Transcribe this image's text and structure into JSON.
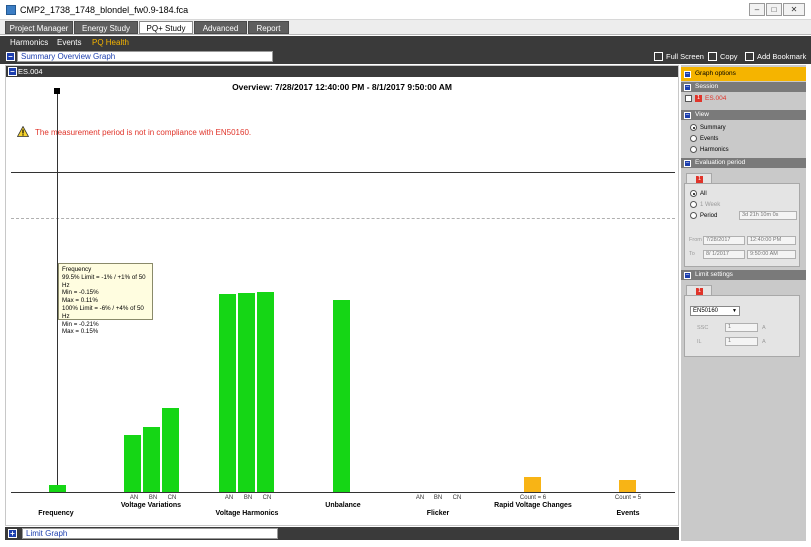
{
  "window": {
    "title": "CMP2_1738_1748_blondel_fw0.9-184.fca",
    "buttons": {
      "minimize": "–",
      "maximize": "□",
      "close": "✕"
    }
  },
  "main_tabs": [
    "Project Manager",
    "Energy Study",
    "PQ+ Study",
    "Advanced",
    "Report"
  ],
  "active_tab": "PQ+ Study",
  "sub_nav": [
    "Harmonics",
    "Events",
    "PQ Health"
  ],
  "active_sub": "PQ Health",
  "toolbar": {
    "panel_title": "Summary Overview Graph",
    "expand_symbol": "–",
    "full_screen": "Full Screen",
    "copy": "Copy",
    "add_bookmark": "Add Bookmark"
  },
  "graph": {
    "session_label": "ES.004",
    "overview": "Overview: 7/28/2017 12:40:00 PM - 8/1/2017 9:50:00 AM",
    "warning": "The measurement period is not in compliance with EN50160.",
    "tooltip": [
      "Frequency",
      "99.5% Limit = -1% / +1% of 50 Hz",
      "Min = -0.15%",
      "Max = 0.11%",
      "100% Limit = -6% / +4% of 50 Hz",
      "Min = -0.21%",
      "Max = 0.15%"
    ]
  },
  "chart_data": {
    "type": "bar",
    "categories": [
      "Frequency",
      "Voltage Variations",
      "Voltage Harmonics",
      "Unbalance",
      "Flicker",
      "Rapid Voltage Changes",
      "Events"
    ],
    "bars": [
      {
        "category": "Frequency",
        "phase": "",
        "value": 0.035,
        "color": "green"
      },
      {
        "category": "Voltage Variations",
        "phase": "AN",
        "value": 0.3,
        "color": "green"
      },
      {
        "category": "Voltage Variations",
        "phase": "BN",
        "value": 0.34,
        "color": "green"
      },
      {
        "category": "Voltage Variations",
        "phase": "CN",
        "value": 0.44,
        "color": "green"
      },
      {
        "category": "Voltage Harmonics",
        "phase": "AN",
        "value": 1.04,
        "color": "green"
      },
      {
        "category": "Voltage Harmonics",
        "phase": "BN",
        "value": 1.045,
        "color": "green"
      },
      {
        "category": "Voltage Harmonics",
        "phase": "CN",
        "value": 1.055,
        "color": "green"
      },
      {
        "category": "Unbalance",
        "phase": "",
        "value": 1.01,
        "color": "green"
      },
      {
        "category": "Flicker",
        "phase": "AN",
        "value": 0,
        "color": "green"
      },
      {
        "category": "Flicker",
        "phase": "BN",
        "value": 0,
        "color": "green"
      },
      {
        "category": "Flicker",
        "phase": "CN",
        "value": 0,
        "color": "green"
      },
      {
        "category": "Rapid Voltage Changes",
        "phase": "Count = 6",
        "value": 0.08,
        "color": "amber"
      },
      {
        "category": "Events",
        "phase": "Count = 5",
        "value": 0.065,
        "color": "amber"
      }
    ],
    "reference_lines": {
      "solid_limit": 1.0,
      "dashed_limit": 1.3
    },
    "colors": {
      "ok": "#15d615",
      "warn": "#f8b415"
    }
  },
  "bottom": {
    "panel_title": "Limit Graph",
    "expand_symbol": "+"
  },
  "sidebar": {
    "graph_options": "Graph options",
    "session_header": "Session",
    "session_item": "ES.004",
    "session_badge": "1",
    "view_header": "View",
    "view_options": [
      "Summary",
      "Events",
      "Harmonics"
    ],
    "view_selected": "Summary",
    "eval_header": "Evaluation period",
    "eval_badge": "1",
    "eval_options": [
      "All",
      "1 Week",
      "Period"
    ],
    "eval_selected": "All",
    "period_duration": "3d 21h 10m 0s",
    "from_label": "From",
    "to_label": "To",
    "from_date": "7/28/2017",
    "from_time": "12:40:00 PM",
    "to_date": "8/ 1/2017",
    "to_time": "9:50:00 AM",
    "limit_header": "Limit settings",
    "limit_badge": "1",
    "standard": "EN50160",
    "ssc_label": "SSC",
    "ssc_value": "1",
    "ssc_unit": "A",
    "il_label": "IL",
    "il_value": "1",
    "il_unit": "A",
    "collapse_symbol": "–"
  }
}
